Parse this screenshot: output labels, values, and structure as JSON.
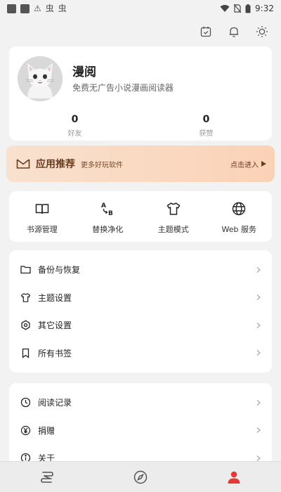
{
  "status_bar": {
    "time": "9:32",
    "left_glyphs": [
      "⚠",
      "虫",
      "虫"
    ]
  },
  "colors": {
    "accent_red": "#e53935",
    "banner_text": "#6a3b1f"
  },
  "header_icons": [
    "calendar-icon",
    "bell-icon",
    "sun-icon"
  ],
  "profile": {
    "name": "漫阅",
    "slogan": "免费无广告小说漫画阅读器",
    "stats": [
      {
        "value": "0",
        "label": "好友"
      },
      {
        "value": "0",
        "label": "获赞"
      }
    ]
  },
  "banner": {
    "title": "应用推荐",
    "subtitle": "更多好玩软件",
    "action": "点击进入"
  },
  "quick_actions": [
    {
      "label": "书源管理",
      "icon": "book-icon"
    },
    {
      "label": "替换净化",
      "icon": "replace-icon"
    },
    {
      "label": "主题模式",
      "icon": "shirt-icon"
    },
    {
      "label": "Web 服务",
      "icon": "globe-icon"
    }
  ],
  "settings_list": [
    {
      "label": "备份与恢复",
      "icon": "folder-icon"
    },
    {
      "label": "主题设置",
      "icon": "shirt-icon"
    },
    {
      "label": "其它设置",
      "icon": "gear-icon"
    },
    {
      "label": "所有书签",
      "icon": "bookmark-icon"
    }
  ],
  "misc_list": [
    {
      "label": "阅读记录",
      "icon": "clock-icon"
    },
    {
      "label": "捐赠",
      "icon": "yen-icon"
    },
    {
      "label": "关于",
      "icon": "info-icon"
    }
  ],
  "bottom_nav": [
    {
      "icon": "bookshelf-icon",
      "active": false
    },
    {
      "icon": "compass-icon",
      "active": false
    },
    {
      "icon": "user-icon",
      "active": true
    }
  ]
}
